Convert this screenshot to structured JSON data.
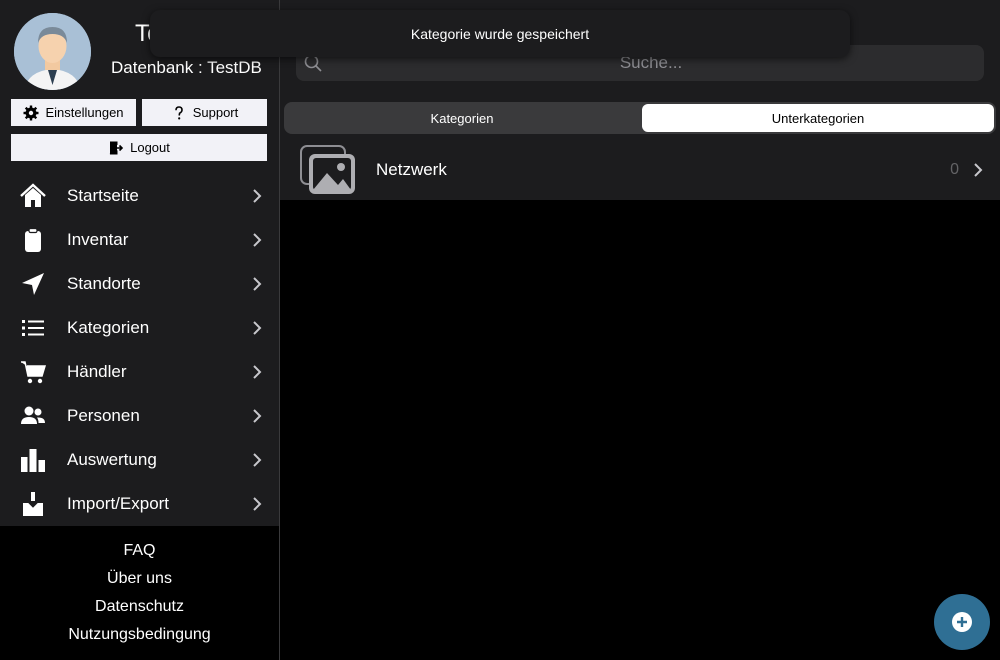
{
  "profile": {
    "name": "Te",
    "database_label": "Datenbank : TestDB"
  },
  "buttons": {
    "settings": "Einstellungen",
    "support": "Support",
    "logout": "Logout"
  },
  "nav": [
    {
      "label": "Startseite",
      "icon": "home-icon"
    },
    {
      "label": "Inventar",
      "icon": "clipboard-icon"
    },
    {
      "label": "Standorte",
      "icon": "location-arrow-icon"
    },
    {
      "label": "Kategorien",
      "icon": "list-icon"
    },
    {
      "label": "Händler",
      "icon": "cart-icon"
    },
    {
      "label": "Personen",
      "icon": "people-icon"
    },
    {
      "label": "Auswertung",
      "icon": "chart-bars-icon"
    },
    {
      "label": "Import/Export",
      "icon": "download-tray-icon"
    }
  ],
  "footer": [
    "FAQ",
    "Über uns",
    "Datenschutz",
    "Nutzungsbedingung"
  ],
  "search": {
    "placeholder": "Suche...",
    "value": ""
  },
  "segments": [
    "Kategorien",
    "Unterkategorien"
  ],
  "selected_segment": "Unterkategorien",
  "list": [
    {
      "title": "Netzwerk",
      "count": "0",
      "icon": "image-placeholder-icon"
    }
  ],
  "toast": "Kategorie wurde gespeichert",
  "colors": {
    "sidebar_bg": "#1c1c1e",
    "background": "#000000",
    "fab": "#2f6f94",
    "segment_active": "#ffffff"
  }
}
